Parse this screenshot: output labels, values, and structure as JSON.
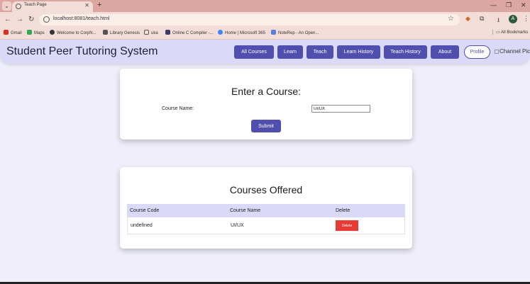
{
  "browser": {
    "tab_title": "Teach Page",
    "url": "localhost:8081/teach.html",
    "bookmarks": [
      "Gmail",
      "Maps",
      "Welcome to CorpN...",
      "Library Genesis",
      "uka",
      "Online C Compiler -...",
      "Home | Microsoft 365",
      "NoteRep - An Open..."
    ],
    "all_bookmarks": "All Bookmarks",
    "profile_initial": "A"
  },
  "header": {
    "title": "Student Peer Tutoring System",
    "nav": [
      "All Courses",
      "Learn",
      "Teach",
      "Learn History",
      "Teach History",
      "About"
    ],
    "profile": "Profile",
    "channel_pic_alt": "Channel Pic"
  },
  "form": {
    "title": "Enter a Course:",
    "course_name_label": "Course Name:",
    "course_name_value": "UI/UX",
    "submit": "Submit"
  },
  "offered": {
    "title": "Courses Offered",
    "columns": [
      "Course Code",
      "Course Name",
      "Delete"
    ],
    "rows": [
      {
        "code": "undefined",
        "name": "UI/UX",
        "delete": "Delete"
      }
    ]
  },
  "colors": {
    "accent": "#514fae",
    "header_bg": "#dad9f8",
    "page_bg": "#efeefa",
    "danger": "#e63a34"
  }
}
